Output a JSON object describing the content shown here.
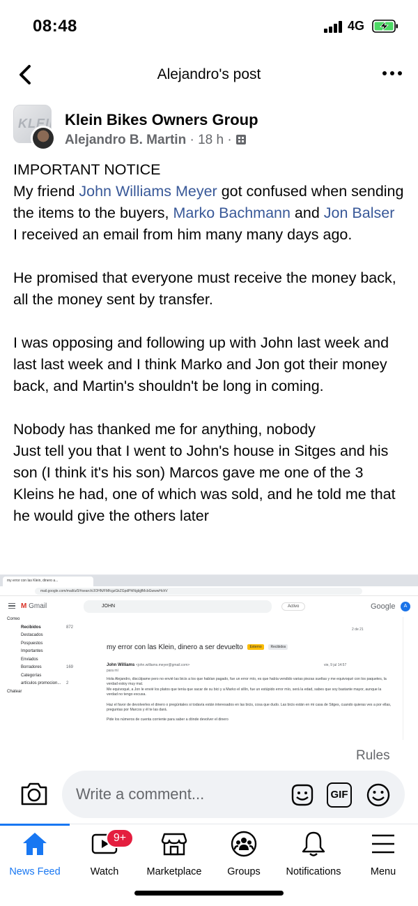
{
  "status_bar": {
    "time": "08:48",
    "network": "4G"
  },
  "header": {
    "title": "Alejandro's post"
  },
  "post": {
    "group_name": "Klein Bikes Owners Group",
    "group_logo_text": "KLEIN",
    "author": "Alejandro B. Martin",
    "time": "18 h",
    "separator": "·",
    "paragraphs": [
      [
        {
          "text": "IMPORTANT NOTICE"
        }
      ],
      [
        {
          "text": "My friend "
        },
        {
          "text": "John Williams Meyer",
          "mention": true
        },
        {
          "text": " got confused when sending the items to the buyers, "
        },
        {
          "text": "Marko Bachmann",
          "mention": true
        },
        {
          "text": " and "
        },
        {
          "text": "Jon Balser",
          "mention": true
        }
      ],
      [
        {
          "text": "I received an email from him many many days ago."
        }
      ],
      [],
      [
        {
          "text": "He promised that everyone must receive the money back, all the money sent by transfer."
        }
      ],
      [],
      [
        {
          "text": "I was opposing and following up with John last week and last last week and I think Marko and Jon got their money back, and Martin's shouldn't be long in coming."
        }
      ],
      [],
      [
        {
          "text": "Nobody has thanked me for anything, nobody"
        }
      ],
      [
        {
          "text": "Just tell you that I went to John's house in Sitges and his son (I think it's his son) Marcos gave me one of the 3 Kleins he had, one of which was sold, and he told me that he would give the others later"
        }
      ]
    ]
  },
  "attached_screenshot": {
    "tab_title": "my error con las Klein, dinero a...",
    "url": "mail.google.com/mail/u/0/#search/JOHN/FMfcgzGkZGpdPhlNgbjjfMcbGwwwHchV",
    "app_name": "Gmail",
    "search_query": "JOHN",
    "status": "Activo",
    "brand": "Google",
    "user_initial": "A",
    "sidebar": [
      "Correo",
      "Recibidos",
      "Destacados",
      "Pospuestos",
      "Importantes",
      "Enviados",
      "Borradores",
      "Categorías",
      "artículos promocion...",
      "Chatear"
    ],
    "inbox_count": "872",
    "drafts_count": "169",
    "promo_count": "2",
    "pager": "2 de 21",
    "subject": "my error con las Klein, dinero a ser devuelto",
    "subject_tag": "Externo",
    "label_tag": "Recibidos",
    "sender": "John Williams",
    "sender_email": "<john.williams.meyer@gmail.com>",
    "to_line": "para mí",
    "date": "vie, 9 jul 14:57",
    "body": [
      "Hola Alejandro, discúlpame pero no envié las bicis a los que habían pagado, fue un error mío, es que había vendido varias piezas sueltas y me equivoqué con los paquetes, la verdad estoy muy mal.",
      "Me equivoqué, a Jon le envié los platos que tenía que sacar de su bici y a Marko el sillín, fue un estúpido error mío, será la edad, sabes que soy bastante mayor, aunque la verdad no tengo excusa.",
      "Haz el favor de devolverles el dinero o pregúntales si todavía están interesados en las bicis, cosa que dudo. Las bicis están en mi casa de Sitges, cuando quieras ves a por ellas, preguntas por Marcos y él te las dará.",
      "Pide los números de cuenta corriente para saber a dónde devolver el dinero"
    ]
  },
  "comments": {
    "rules_label": "Rules",
    "placeholder": "Write a comment...",
    "gif_label": "GIF"
  },
  "bottom_nav": {
    "items": [
      {
        "label": "News Feed",
        "icon": "home-icon",
        "active": true
      },
      {
        "label": "Watch",
        "icon": "watch-icon",
        "badge": "9+"
      },
      {
        "label": "Marketplace",
        "icon": "marketplace-icon"
      },
      {
        "label": "Groups",
        "icon": "groups-icon"
      },
      {
        "label": "Notifications",
        "icon": "bell-icon"
      },
      {
        "label": "Menu",
        "icon": "menu-icon"
      }
    ]
  },
  "colors": {
    "accent": "#1877f2",
    "mention": "#385898",
    "badge": "#e41e3f",
    "secondary_text": "#65676b",
    "input_bg": "#f0f2f5"
  }
}
